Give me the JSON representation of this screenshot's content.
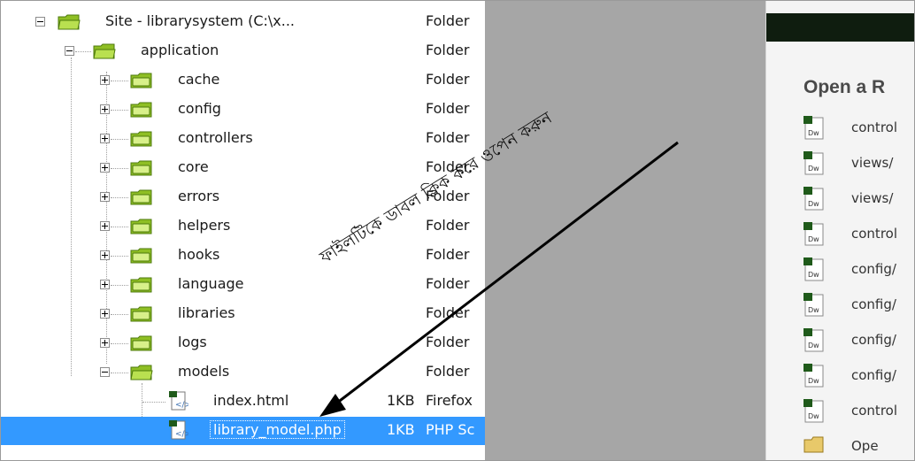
{
  "tree": {
    "rows": [
      {
        "label": "Site - librarysystem (C:\\x...",
        "type": "Folder"
      },
      {
        "label": "application",
        "type": "Folder"
      },
      {
        "label": "cache",
        "type": "Folder"
      },
      {
        "label": "config",
        "type": "Folder"
      },
      {
        "label": "controllers",
        "type": "Folder"
      },
      {
        "label": "core",
        "type": "Folder"
      },
      {
        "label": "errors",
        "type": "Folder"
      },
      {
        "label": "helpers",
        "type": "Folder"
      },
      {
        "label": "hooks",
        "type": "Folder"
      },
      {
        "label": "language",
        "type": "Folder"
      },
      {
        "label": "libraries",
        "type": "Folder"
      },
      {
        "label": "logs",
        "type": "Folder"
      },
      {
        "label": "models",
        "type": "Folder"
      }
    ],
    "files": [
      {
        "label": "index.html",
        "size": "1KB",
        "type": "Firefox"
      },
      {
        "label": "library_model.php",
        "size": "1KB",
        "type": "PHP Sc"
      }
    ]
  },
  "start_page": {
    "heading": "Open a R",
    "recent_items": [
      "control",
      "views/",
      "views/",
      "control",
      "config/",
      "config/",
      "config/",
      "config/",
      "control",
      "Ope"
    ]
  },
  "annotation": {
    "text": "ফাইলটিকে ডাবল ক্লিক করে ওপেন করুন"
  },
  "colors": {
    "selection": "#3399ff",
    "folder": "#a8d63a",
    "grey_panel": "#a6a6a6",
    "start_topbar": "#0f1d0f"
  }
}
